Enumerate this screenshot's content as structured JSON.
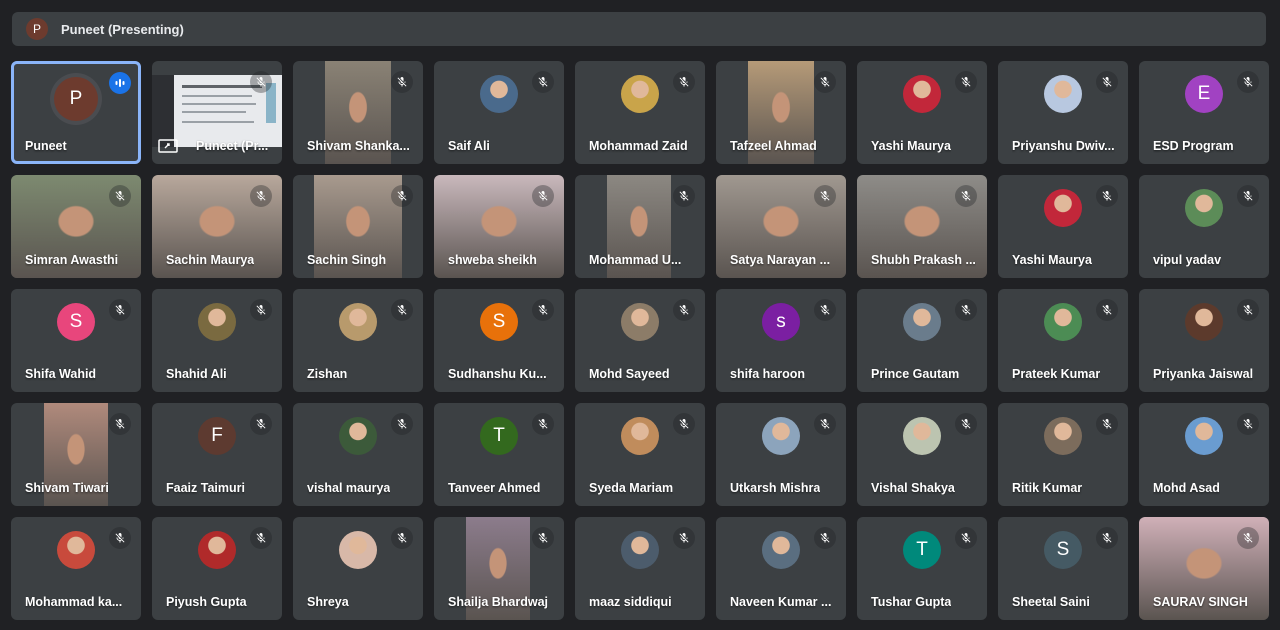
{
  "presenting_bar": {
    "avatar_initial": "P",
    "title": "Puneet (Presenting)"
  },
  "participants": [
    {
      "name": "Puneet",
      "initial": "P",
      "kind": "letter",
      "color": "#6d3b2e",
      "status": "speaking",
      "active": true
    },
    {
      "name": "Puneet (Pr...",
      "kind": "screen",
      "status": "muted-screen"
    },
    {
      "name": "Shivam Shanka...",
      "kind": "video",
      "color": "#8a8275",
      "vw": 66,
      "vx": 32
    },
    {
      "name": "Saif Ali",
      "kind": "photo",
      "color": "#4a6a8c"
    },
    {
      "name": "Mohammad Zaid",
      "kind": "photo",
      "color": "#c9a44a"
    },
    {
      "name": "Tafzeel Ahmad",
      "kind": "video",
      "color": "#b59a78",
      "vw": 66,
      "vx": 32
    },
    {
      "name": "Yashi Maurya",
      "kind": "photo",
      "color": "#c2273a"
    },
    {
      "name": "Priyanshu Dwiv...",
      "kind": "photo",
      "color": "#b8c8e0"
    },
    {
      "name": "ESD Program",
      "initial": "E",
      "kind": "letter",
      "color": "#a142c2"
    },
    {
      "name": "Simran Awasthi",
      "kind": "video",
      "color": "#7d8a70",
      "vw": 130,
      "vx": 0
    },
    {
      "name": "Sachin Maurya",
      "kind": "video",
      "color": "#b8a89c",
      "vw": 130,
      "vx": 0
    },
    {
      "name": "Sachin Singh",
      "kind": "video",
      "color": "#a89a8e",
      "vw": 88,
      "vx": 21
    },
    {
      "name": "shweba sheikh",
      "kind": "video",
      "color": "#c9b8bc",
      "vw": 130,
      "vx": 0
    },
    {
      "name": "Mohammad U...",
      "kind": "video",
      "color": "#8c8882",
      "vw": 64,
      "vx": 32
    },
    {
      "name": "Satya Narayan ...",
      "kind": "video",
      "color": "#a09890",
      "vw": 130,
      "vx": 0
    },
    {
      "name": "Shubh Prakash ...",
      "kind": "video",
      "color": "#8e8c88",
      "vw": 130,
      "vx": 0
    },
    {
      "name": "Yashi Maurya",
      "kind": "photo",
      "color": "#c2273a"
    },
    {
      "name": "vipul yadav",
      "kind": "photo",
      "color": "#5c8c58"
    },
    {
      "name": "Shifa Wahid",
      "initial": "S",
      "kind": "letter",
      "color": "#e8467c"
    },
    {
      "name": "Shahid Ali",
      "kind": "photo",
      "color": "#7a6a40"
    },
    {
      "name": "Zishan",
      "kind": "photo",
      "color": "#b89a6c"
    },
    {
      "name": "Sudhanshu Ku...",
      "initial": "S",
      "kind": "letter",
      "color": "#e8710a"
    },
    {
      "name": "Mohd Sayeed",
      "kind": "photo",
      "color": "#8c7c68"
    },
    {
      "name": "shifa haroon",
      "initial": "s",
      "kind": "letter",
      "color": "#7b1fa2"
    },
    {
      "name": "Prince Gautam",
      "kind": "photo",
      "color": "#6a7c8c"
    },
    {
      "name": "Prateek Kumar",
      "kind": "photo",
      "color": "#4c8c54"
    },
    {
      "name": "Priyanka Jaiswal",
      "kind": "photo",
      "color": "#5c3a2c"
    },
    {
      "name": "Shivam Tiwari",
      "kind": "video",
      "color": "#b08a7c",
      "vw": 64,
      "vx": 33
    },
    {
      "name": "Faaiz Taimuri",
      "initial": "F",
      "kind": "letter",
      "color": "#5d3a30"
    },
    {
      "name": "vishal maurya",
      "kind": "photo",
      "color": "#3c5a3a"
    },
    {
      "name": "Tanveer Ahmed",
      "initial": "T",
      "kind": "letter",
      "color": "#33691e"
    },
    {
      "name": "Syeda Mariam",
      "kind": "photo",
      "color": "#c08c5c"
    },
    {
      "name": "Utkarsh Mishra",
      "kind": "photo",
      "color": "#8ca4bc"
    },
    {
      "name": "Vishal Shakya",
      "kind": "photo",
      "color": "#bcc4b0"
    },
    {
      "name": "Ritik Kumar",
      "kind": "photo",
      "color": "#7c6c5c"
    },
    {
      "name": "Mohd Asad",
      "kind": "photo",
      "color": "#6a9cd0"
    },
    {
      "name": "Mohammad ka...",
      "kind": "photo",
      "color": "#c84a3c"
    },
    {
      "name": "Piyush Gupta",
      "kind": "photo",
      "color": "#b02a2a"
    },
    {
      "name": "Shreya",
      "kind": "photo",
      "color": "#d8b8a8"
    },
    {
      "name": "Shailja Bhardwaj",
      "kind": "video",
      "color": "#8c7c8c",
      "vw": 64,
      "vx": 32
    },
    {
      "name": "maaz siddiqui",
      "kind": "photo",
      "color": "#4c5c6c"
    },
    {
      "name": "Naveen Kumar ...",
      "kind": "photo",
      "color": "#5a6e80"
    },
    {
      "name": "Tushar Gupta",
      "initial": "T",
      "kind": "letter",
      "color": "#00897b"
    },
    {
      "name": "Sheetal Saini",
      "initial": "S",
      "kind": "letter",
      "color": "#455a64"
    },
    {
      "name": "SAURAV SINGH",
      "kind": "video",
      "color": "#d0b0b8",
      "vw": 130,
      "vx": 0
    }
  ]
}
